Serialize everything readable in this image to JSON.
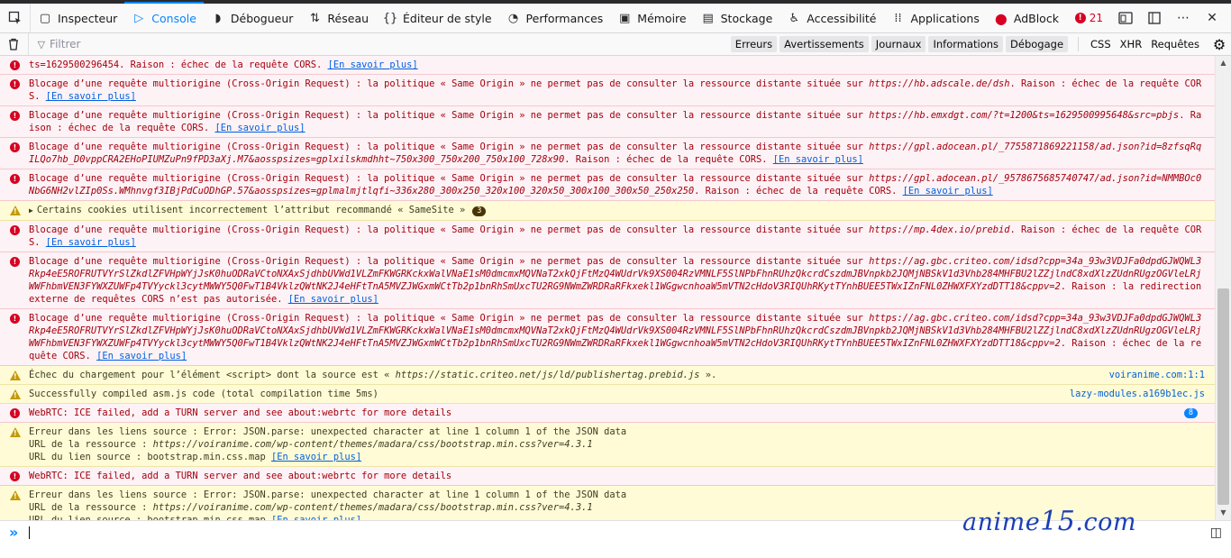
{
  "toolbar": {
    "tabs": [
      {
        "label": "Inspecteur",
        "icon": "inspector-icon"
      },
      {
        "label": "Console",
        "icon": "console-icon"
      },
      {
        "label": "Débogueur",
        "icon": "debugger-icon"
      },
      {
        "label": "Réseau",
        "icon": "network-icon"
      },
      {
        "label": "Éditeur de style",
        "icon": "style-editor-icon"
      },
      {
        "label": "Performances",
        "icon": "performance-icon"
      },
      {
        "label": "Mémoire",
        "icon": "memory-icon"
      },
      {
        "label": "Stockage",
        "icon": "storage-icon"
      },
      {
        "label": "Accessibilité",
        "icon": "accessibility-icon"
      },
      {
        "label": "Applications",
        "icon": "applications-icon"
      },
      {
        "label": "AdBlock",
        "icon": "adblock-icon"
      }
    ],
    "error_count": "21"
  },
  "filterbar": {
    "placeholder": "Filtrer",
    "levels": [
      "Erreurs",
      "Avertissements",
      "Journaux",
      "Informations",
      "Débogage"
    ],
    "requests": [
      "CSS",
      "XHR",
      "Requêtes"
    ]
  },
  "messages": [
    {
      "type": "error",
      "pre": "ts=1629500296454. Raison : échec de la requête CORS. ",
      "url": "",
      "post": "",
      "link": "[En savoir plus]"
    },
    {
      "type": "error",
      "pre": "Blocage d’une requête multiorigine (Cross-Origin Request) : la politique « Same Origin » ne permet pas de consulter la ressource distante située sur ",
      "url": "https://hb.adscale.de/dsh",
      "post": ". Raison : échec de la requête CORS. ",
      "link": "[En savoir plus]"
    },
    {
      "type": "error",
      "pre": "Blocage d’une requête multiorigine (Cross-Origin Request) : la politique « Same Origin » ne permet pas de consulter la ressource distante située sur ",
      "url": "https://hb.emxdgt.com/?t=1200&ts=1629500995648&src=pbjs",
      "post": ". Raison : échec de la requête CORS. ",
      "link": "[En savoir plus]"
    },
    {
      "type": "error",
      "pre": "Blocage d’une requête multiorigine (Cross-Origin Request) : la politique « Same Origin » ne permet pas de consulter la ressource distante située sur ",
      "url": "https://gpl.adocean.pl/_7755871869221158/ad.json?id=8zfsqRqILQo7hb_D0vppCRA2EHoPIUMZuPn9fPD3aXj.M7&aosspsizes=gplxilskmdhht~750x300_750x200_750x100_728x90",
      "post": ". Raison : échec de la requête CORS. ",
      "link": "[En savoir plus]"
    },
    {
      "type": "error",
      "pre": "Blocage d’une requête multiorigine (Cross-Origin Request) : la politique « Same Origin » ne permet pas de consulter la ressource distante située sur ",
      "url": "https://gpl.adocean.pl/_9578675685740747/ad.json?id=NMMBOc0NbG6NH2vlZIp0Ss.WMhnvgf3IBjPdCuODhGP.57&aosspsizes=gplmalmjtlqfi~336x280_300x250_320x100_320x50_300x100_300x50_250x250",
      "post": ". Raison : échec de la requête CORS. ",
      "link": "[En savoir plus]"
    },
    {
      "type": "warn",
      "pre": "Certains cookies utilisent incorrectement l’attribut recommandé « SameSite »",
      "url": "",
      "post": "",
      "link": "",
      "badge": "3",
      "expand": true
    },
    {
      "type": "error",
      "pre": "Blocage d’une requête multiorigine (Cross-Origin Request) : la politique « Same Origin » ne permet pas de consulter la ressource distante située sur ",
      "url": "https://mp.4dex.io/prebid",
      "post": ". Raison : échec de la requête CORS. ",
      "link": "[En savoir plus]"
    },
    {
      "type": "error",
      "pre": "Blocage d’une requête multiorigine (Cross-Origin Request) : la politique « Same Origin » ne permet pas de consulter la ressource distante située sur ",
      "url": "https://ag.gbc.criteo.com/idsd?cpp=34a_93w3VDJFa0dpdGJWQWL3Rkp4eE5ROFRUTVYrSlZkdlZFVHpWYjJsK0huODRaVCtoNXAxSjdhbUVWd1VLZmFKWGRKckxWalVNaE1sM0dmcmxMQVNaT2xkQjFtMzQ4WUdrVk9XS004RzVMNLF5SlNPbFhnRUhzQkcrdCszdmJBVnpkb2JQMjNBSkV1d3Vhb284MHFBU2lZZjlndC8xdXlzZUdnRUgzOGVleLRjWWFhbmVEN3FYWXZUWFp4TVYyckl3cytMWWY5Q0FwT1B4VklzQWtNK2J4eHFtTnA5MVZJWGxmWCtTb2p1bnRhSmUxcTU2RG9NWmZWRDRaRFkxekl1WGgwcnhoaW5mVTN2cHdoV3RIQUhRKytTYnhBUEE5TWxIZnFNL0ZHWXFXYzdDTT18&cppv=2",
      "post": ". Raison : la redirection externe de requêtes CORS n’est pas autorisée. ",
      "link": "[En savoir plus]"
    },
    {
      "type": "error",
      "pre": "Blocage d’une requête multiorigine (Cross-Origin Request) : la politique « Same Origin » ne permet pas de consulter la ressource distante située sur ",
      "url": "https://ag.gbc.criteo.com/idsd?cpp=34a_93w3VDJFa0dpdGJWQWL3Rkp4eE5ROFRUTVYrSlZkdlZFVHpWYjJsK0huODRaVCtoNXAxSjdhbUVWd1VLZmFKWGRKckxWalVNaE1sM0dmcmxMQVNaT2xkQjFtMzQ4WUdrVk9XS004RzVMNLF5SlNPbFhnRUhzQkcrdCszdmJBVnpkb2JQMjNBSkV1d3Vhb284MHFBU2lZZjlndC8xdXlzZUdnRUgzOGVleLRjWWFhbmVEN3FYWXZUWFp4TVYyckl3cytMWWY5Q0FwT1B4VklzQWtNK2J4eHFtTnA5MVZJWGxmWCtTb2p1bnRhSmUxcTU2RG9NWmZWRDRaRFkxekl1WGgwcnhoaW5mVTN2cHdoV3RIQUhRKytTYnhBUEE5TWxIZnFNL0ZHWXFXYzdDTT18&cppv=2",
      "post": ". Raison : échec de la requête CORS. ",
      "link": "[En savoir plus]"
    },
    {
      "type": "warn",
      "pre": "Échec du chargement pour l’élément <script> dont la source est « ",
      "url": "https://static.criteo.net/js/ld/publishertag.prebid.js",
      "post": " ».",
      "link": "",
      "source": "voiranime.com:1:1"
    },
    {
      "type": "warn",
      "pre": "Successfully compiled asm.js code (total compilation time 5ms)",
      "url": "",
      "post": "",
      "link": "",
      "source": "lazy-modules.a169b1ec.js"
    },
    {
      "type": "error",
      "pre": "WebRTC: ICE failed, add a TURN server and see about:webrtc for more details",
      "url": "",
      "post": "",
      "link": "",
      "repeat": "8"
    },
    {
      "type": "warn",
      "pre": "Erreur dans les liens source : Error: JSON.parse: unexpected character at line 1 column 1 of the JSON data\nURL de la ressource : ",
      "url": "https://voiranime.com/wp-content/themes/madara/css/bootstrap.min.css?ver=4.3.1",
      "post": "\nURL du lien source : bootstrap.min.css.map ",
      "link": "[En savoir plus]"
    },
    {
      "type": "error",
      "pre": "WebRTC: ICE failed, add a TURN server and see about:webrtc for more details",
      "url": "",
      "post": "",
      "link": ""
    },
    {
      "type": "warn",
      "pre": "Erreur dans les liens source : Error: JSON.parse: unexpected character at line 1 column 1 of the JSON data\nURL de la ressource : ",
      "url": "https://voiranime.com/wp-content/themes/madara/css/bootstrap.min.css?ver=4.3.1",
      "post": "\nURL du lien source : bootstrap.min.css.map ",
      "link": "[En savoir plus]"
    }
  ],
  "input": {
    "prompt": "»"
  },
  "watermark": {
    "text": "anime",
    "num": "15",
    "suffix": ".com"
  }
}
